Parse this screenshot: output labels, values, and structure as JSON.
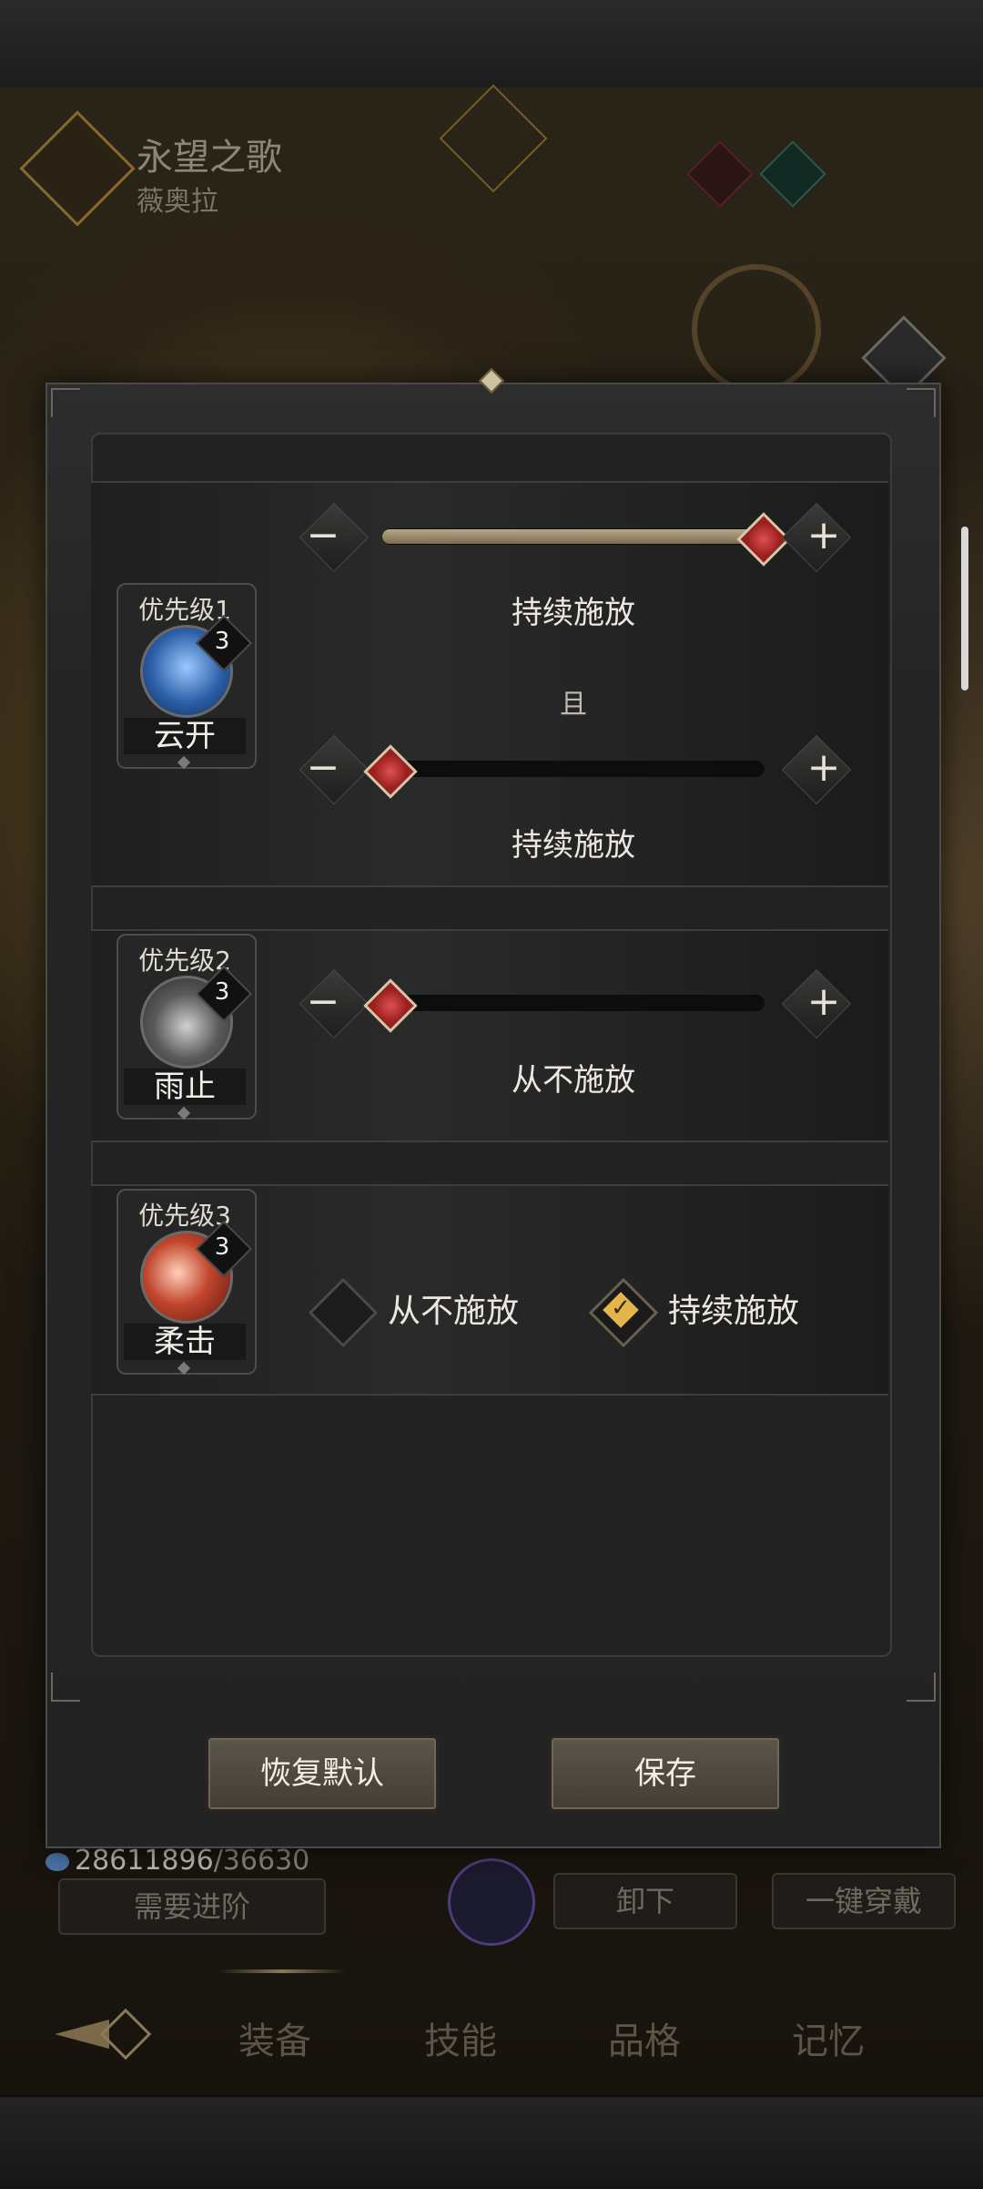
{
  "background": {
    "hero_name": "永望之歌",
    "hero_subtitle": "薇奥拉",
    "gold": {
      "current": "28611896",
      "max": "/36630"
    },
    "advance_button": "需要进阶",
    "unequip_button": "卸下",
    "equip_all_button": "一键穿戴",
    "tabs": [
      "装备",
      "技能",
      "品格",
      "记忆"
    ]
  },
  "modal": {
    "rows": [
      {
        "skill": {
          "priority": "优先级1",
          "name": "云开",
          "level": "3",
          "icon": "sword-rain-icon"
        },
        "conditions": [
          {
            "caption": "持续施放",
            "slider_value": 1.0
          },
          {
            "caption": "持续施放",
            "slider_value": 0.0
          }
        ],
        "connector": "且"
      },
      {
        "skill": {
          "priority": "优先级2",
          "name": "雨止",
          "level": "3",
          "icon": "raindrop-icon"
        },
        "conditions": [
          {
            "caption": "从不施放",
            "slider_value": 0.0
          }
        ]
      },
      {
        "skill": {
          "priority": "优先级3",
          "name": "柔击",
          "level": "3",
          "icon": "red-swirl-icon"
        },
        "options": [
          {
            "label": "从不施放",
            "checked": false
          },
          {
            "label": "持续施放",
            "checked": true
          }
        ]
      }
    ],
    "minus_glyph": "−",
    "plus_glyph": "+",
    "reset_button": "恢复默认",
    "save_button": "保存"
  },
  "colors": {
    "accent_gold": "#e3b54a",
    "thumb_red": "#c03030",
    "slider_fill": "#b8a888"
  }
}
